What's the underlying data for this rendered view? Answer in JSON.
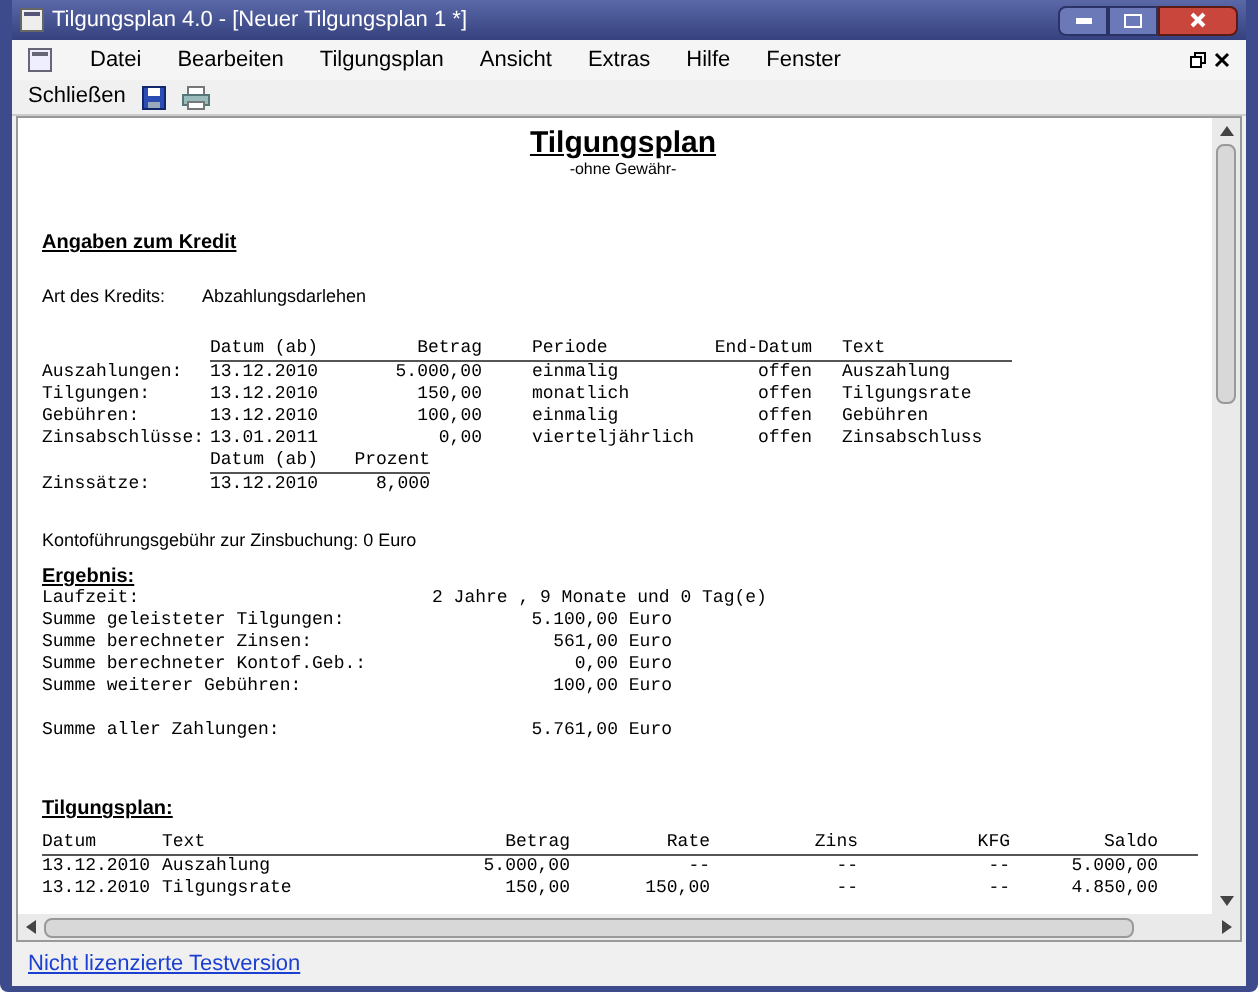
{
  "window": {
    "title": "Tilgungsplan 4.0 - [Neuer Tilgungsplan 1 *]"
  },
  "menu": [
    "Datei",
    "Bearbeiten",
    "Tilgungsplan",
    "Ansicht",
    "Extras",
    "Hilfe",
    "Fenster"
  ],
  "toolbar": {
    "close_label": "Schließen"
  },
  "document": {
    "title": "Tilgungsplan",
    "subtitle": "-ohne Gewähr-",
    "credit_heading": "Angaben zum Kredit",
    "credit_type": {
      "label": "Art des Kredits:",
      "value": "Abzahlungsdarlehen"
    },
    "flows": {
      "columns": [
        "",
        "Datum (ab)",
        "Betrag",
        "Periode",
        "End-Datum",
        "Text"
      ],
      "rows": [
        [
          "Auszahlungen:",
          "13.12.2010",
          "5.000,00",
          "einmalig",
          "offen",
          "Auszahlung"
        ],
        [
          "Tilgungen:",
          "13.12.2010",
          "150,00",
          "monatlich",
          "offen",
          "Tilgungsrate"
        ],
        [
          "Gebühren:",
          "13.12.2010",
          "100,00",
          "einmalig",
          "offen",
          "Gebühren"
        ],
        [
          "Zinsabschlüsse:",
          "13.01.2011",
          "0,00",
          "vierteljährlich",
          "offen",
          "Zinsabschluss"
        ]
      ]
    },
    "rates": {
      "columns": [
        "",
        "Datum (ab)",
        "Prozent"
      ],
      "rows": [
        [
          "Zinssätze:",
          "13.12.2010",
          "8,000"
        ]
      ]
    },
    "fee_note": "Kontoführungsgebühr zur Zinsbuchung: 0 Euro",
    "result_heading": "Ergebnis:",
    "results": [
      {
        "kind": "duration",
        "label": "Laufzeit:",
        "value": "2 Jahre , 9 Monate und 0 Tag(e)"
      },
      {
        "kind": "sum",
        "label": "Summe geleisteter Tilgungen:",
        "value": "5.100,00 Euro"
      },
      {
        "kind": "sum",
        "label": "Summe berechneter Zinsen:",
        "value": "561,00 Euro"
      },
      {
        "kind": "sum",
        "label": "Summe berechneter Kontof.Geb.:",
        "value": "0,00 Euro"
      },
      {
        "kind": "sum",
        "label": "Summe weiterer Gebühren:",
        "value": "100,00 Euro"
      },
      {
        "kind": "gap"
      },
      {
        "kind": "sum",
        "label": "Summe aller Zahlungen:",
        "value": "5.761,00 Euro"
      }
    ],
    "plan_heading": "Tilgungsplan:",
    "plan": {
      "columns": [
        "Datum",
        "Text",
        "Betrag",
        "Rate",
        "Zins",
        "KFG",
        "Saldo"
      ],
      "rows": [
        [
          "13.12.2010",
          "Auszahlung",
          "5.000,00",
          "--",
          "--",
          "--",
          "5.000,00"
        ],
        [
          "13.12.2010",
          "Tilgungsrate",
          "150,00",
          "150,00",
          "--",
          "--",
          "4.850,00"
        ]
      ]
    }
  },
  "status_bar": {
    "link": "Nicht lizenzierte Testversion"
  }
}
